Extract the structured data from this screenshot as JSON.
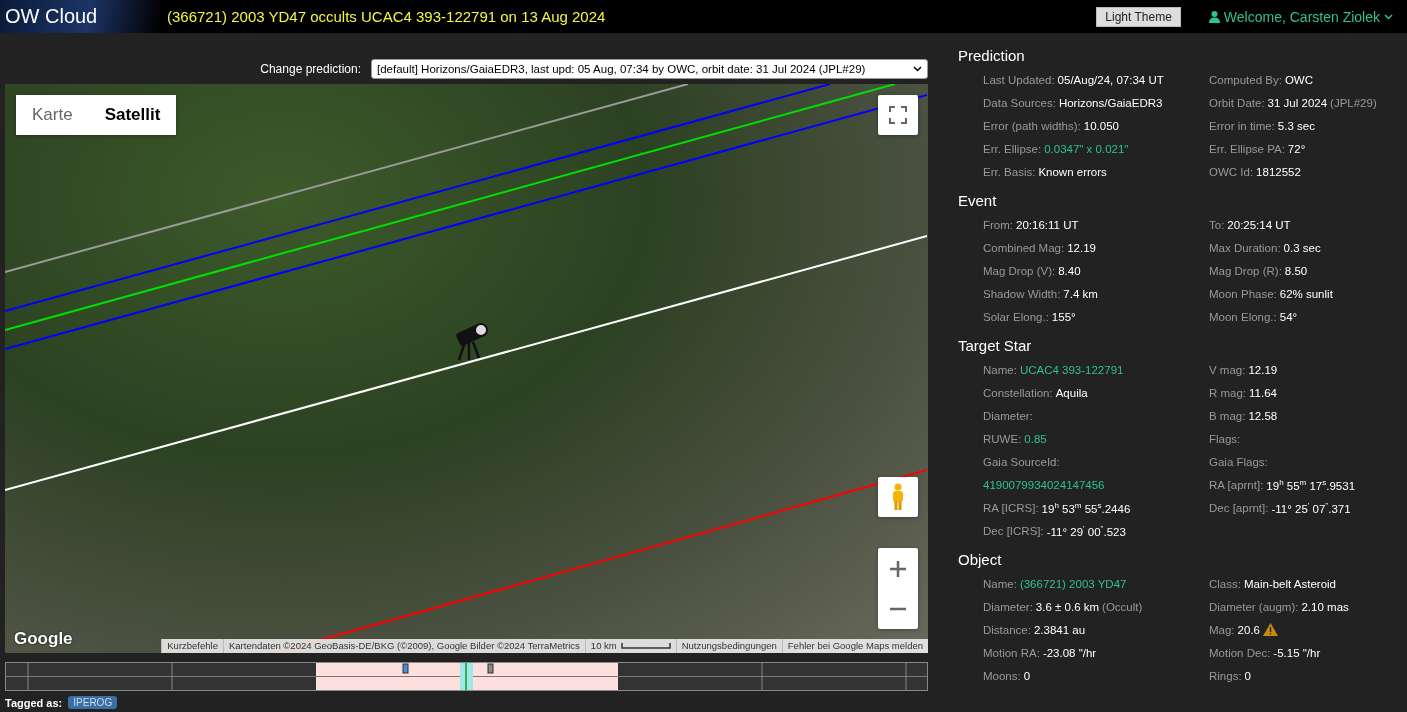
{
  "header": {
    "logo": "OW Cloud",
    "title": "(366721) 2003 YD47 occults UCAC4 393-122791 on 13 Aug 2024",
    "theme_button": "Light Theme",
    "user": "Welcome, Carsten Ziolek"
  },
  "prediction_select": {
    "label": "Change prediction:",
    "value": "[default] Horizons/GaiaEDR3, last upd: 05 Aug, 07:34 by OWC, orbit date: 31 Jul 2024 (JPL#29)"
  },
  "map": {
    "type_tabs": [
      {
        "label": "Karte",
        "selected": false
      },
      {
        "label": "Satellit",
        "selected": true
      }
    ],
    "paths": [
      {
        "color": "#9a9a9a"
      },
      {
        "color": "#0000ff"
      },
      {
        "color": "#00e000"
      },
      {
        "color": "#0000ff"
      },
      {
        "color": "#ffffff"
      },
      {
        "color": "#ff0000"
      }
    ],
    "logo": "Google",
    "attribution": {
      "shortcuts": "Kurzbefehle",
      "data": "Kartendaten ©2024 GeoBasis-DE/BKG (©2009), Google Bilder ©2024 TerraMetrics",
      "scale": "10 km",
      "terms": "Nutzungsbedingungen",
      "report": "Fehler bei Google Maps melden"
    }
  },
  "tags": {
    "label": "Tagged as:",
    "items": [
      "IPEROG"
    ]
  },
  "sections": [
    {
      "title": "Prediction",
      "rows": [
        {
          "left": {
            "label": "Last Updated:",
            "value": "05/Aug/24, 07:34 UT"
          },
          "right": {
            "label": "Computed By:",
            "value": "OWC"
          }
        },
        {
          "left": {
            "label": "Data Sources:",
            "value": "Horizons/GaiaEDR3"
          },
          "right": {
            "label": "Orbit Date:",
            "value": "31 Jul 2024",
            "note": "(JPL#29)"
          }
        },
        {
          "left": {
            "label": "Error (path widths):",
            "value": "10.050"
          },
          "right": {
            "label": "Error in time:",
            "value": "5.3 sec"
          }
        },
        {
          "left": {
            "label": "Err. Ellipse:",
            "value": "0.0347\" x 0.021\"",
            "link": true
          },
          "right": {
            "label": "Err. Ellipse PA:",
            "value": "72°"
          }
        },
        {
          "left": {
            "label": "Err. Basis:",
            "value": "Known errors"
          },
          "right": {
            "label": "OWC Id:",
            "value": "1812552"
          }
        }
      ]
    },
    {
      "title": "Event",
      "rows": [
        {
          "left": {
            "label": "From:",
            "value": "20:16:11 UT"
          },
          "right": {
            "label": "To:",
            "value": "20:25:14 UT"
          }
        },
        {
          "left": {
            "label": "Combined Mag:",
            "value": "12.19"
          },
          "right": {
            "label": "Max Duration:",
            "value": "0.3 sec"
          }
        },
        {
          "left": {
            "label": "Mag Drop (V):",
            "value": "8.40"
          },
          "right": {
            "label": "Mag Drop (R):",
            "value": "8.50"
          }
        },
        {
          "left": {
            "label": "Shadow Width:",
            "value": "7.4 km"
          },
          "right": {
            "label": "Moon Phase:",
            "value": "62% sunlit"
          }
        },
        {
          "left": {
            "label": "Solar Elong.:",
            "value": "155°"
          },
          "right": {
            "label": "Moon Elong.:",
            "value": "54°"
          }
        }
      ]
    },
    {
      "title": "Target Star",
      "rows": [
        {
          "left": {
            "label": "Name:",
            "value": "UCAC4 393-122791",
            "link": true
          },
          "right": {
            "label": "V mag:",
            "value": "12.19"
          }
        },
        {
          "left": {
            "label": "Constellation:",
            "value": "Aquila"
          },
          "right": {
            "label": "R mag:",
            "value": "11.64"
          }
        },
        {
          "left": {
            "label": "Diameter:"
          },
          "right": {
            "label": "B mag:",
            "value": "12.58"
          }
        },
        {
          "left": {
            "label": "RUWE:",
            "value": "0.85",
            "link": true
          },
          "right": {
            "label": "Flags:"
          }
        },
        {
          "left": {
            "label": "Gaia SourceId:"
          },
          "right": {
            "label": "Gaia Flags:"
          }
        },
        {
          "left": {
            "value": "4190079934024147456",
            "link": true
          },
          "right": {
            "label": "RA [aprnt]:",
            "value": "19$^{h}$ 55$^{m}$ 17$^{s}$.9531"
          }
        },
        {
          "left": {
            "label": "RA [ICRS]:",
            "value": "19$^{h}$ 53$^{m}$ 55$^{s}$.2446"
          },
          "right": {
            "label": "Dec [aprnt]:",
            "value": "-11° 25$^{'}$ 07$^{\"}$.371"
          }
        },
        {
          "left": {
            "label": "Dec [ICRS]:",
            "value": "-11° 29$^{'}$ 00$^{\"}$.523"
          }
        }
      ]
    },
    {
      "title": "Object",
      "rows": [
        {
          "left": {
            "label": "Name:",
            "value": "(366721) 2003 YD47",
            "link": true
          },
          "right": {
            "label": "Class:",
            "value": "Main-belt Asteroid"
          }
        },
        {
          "left": {
            "label": "Diameter:",
            "value": "3.6 ± 0.6 km",
            "note": "(Occult)"
          },
          "right": {
            "label": "Diameter (augm):",
            "value": "2.10 mas"
          }
        },
        {
          "left": {
            "label": "Distance:",
            "value": "2.3841 au"
          },
          "right": {
            "label": "Mag:",
            "value": "20.6",
            "warning": true
          }
        },
        {
          "left": {
            "label": "Motion RA:",
            "value": "-23.08 \"/hr"
          },
          "right": {
            "label": "Motion Dec:",
            "value": "-5.15 \"/hr"
          }
        },
        {
          "left": {
            "label": "Moons:",
            "value": "0"
          },
          "right": {
            "label": "Rings:",
            "value": "0"
          }
        }
      ]
    }
  ]
}
